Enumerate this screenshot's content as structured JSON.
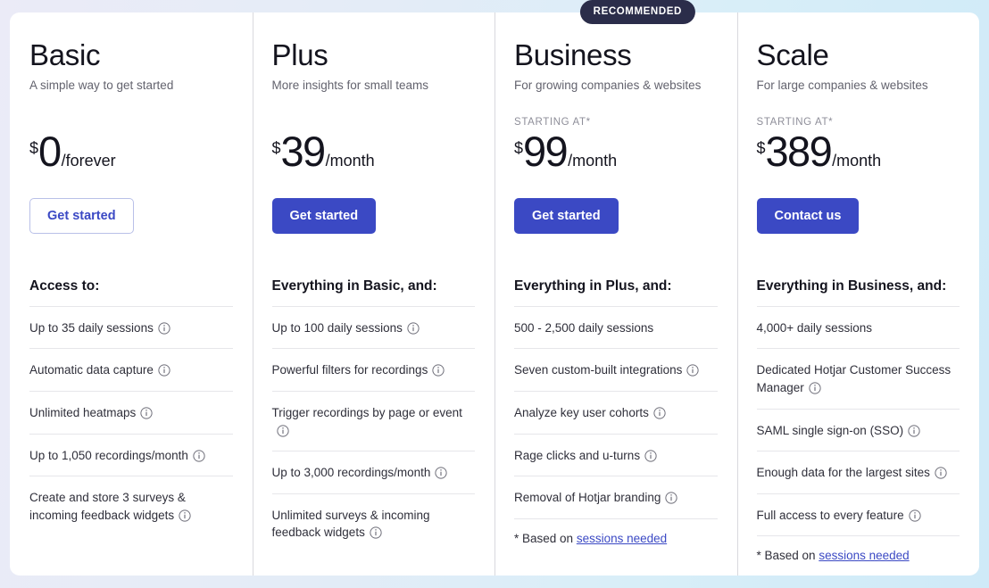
{
  "badge": {
    "recommended_label": "RECOMMENDED"
  },
  "icons": {
    "info": "info-icon"
  },
  "colors": {
    "accent": "#3b49c4",
    "badge_background": "#2b2d4a",
    "text_primary": "#14141e",
    "text_muted": "#63636e",
    "divider": "#e6e6ea"
  },
  "plans": [
    {
      "id": "basic",
      "name": "Basic",
      "tagline": "A simple way to get started",
      "starting_at": "",
      "currency": "$",
      "amount": "0",
      "period": "/forever",
      "cta_label": "Get started",
      "cta_style": "outline",
      "recommended": false,
      "features_heading": "Access to:",
      "features": [
        {
          "text": "Up to 35 daily sessions",
          "info": true
        },
        {
          "text": "Automatic data capture",
          "info": true
        },
        {
          "text": "Unlimited heatmaps",
          "info": true
        },
        {
          "text": "Up to 1,050 recordings/month",
          "info": true
        },
        {
          "text": "Create and store 3 surveys & incoming feedback widgets",
          "info": true
        }
      ],
      "footnote": null
    },
    {
      "id": "plus",
      "name": "Plus",
      "tagline": "More insights for small teams",
      "starting_at": "",
      "currency": "$",
      "amount": "39",
      "period": "/month",
      "cta_label": "Get started",
      "cta_style": "filled",
      "recommended": false,
      "features_heading": "Everything in Basic, and:",
      "features": [
        {
          "text": "Up to 100 daily sessions",
          "info": true
        },
        {
          "text": "Powerful filters for recordings",
          "info": true
        },
        {
          "text": "Trigger recordings by page or event",
          "info": true
        },
        {
          "text": "Up to 3,000 recordings/month",
          "info": true
        },
        {
          "text": "Unlimited surveys & incoming feedback widgets",
          "info": true
        }
      ],
      "footnote": null
    },
    {
      "id": "business",
      "name": "Business",
      "tagline": "For growing companies & websites",
      "starting_at": "STARTING AT*",
      "currency": "$",
      "amount": "99",
      "period": "/month",
      "cta_label": "Get started",
      "cta_style": "filled",
      "recommended": true,
      "features_heading": "Everything in Plus, and:",
      "features": [
        {
          "text": "500 - 2,500 daily sessions",
          "info": false
        },
        {
          "text": "Seven custom-built integrations",
          "info": true
        },
        {
          "text": "Analyze key user cohorts",
          "info": true
        },
        {
          "text": "Rage clicks and u-turns",
          "info": true
        },
        {
          "text": "Removal of Hotjar branding",
          "info": true
        }
      ],
      "footnote": {
        "prefix": "* Based on ",
        "link_text": "sessions needed"
      }
    },
    {
      "id": "scale",
      "name": "Scale",
      "tagline": "For large companies & websites",
      "starting_at": "STARTING AT*",
      "currency": "$",
      "amount": "389",
      "period": "/month",
      "cta_label": "Contact us",
      "cta_style": "filled",
      "recommended": false,
      "features_heading": "Everything in Business, and:",
      "features": [
        {
          "text": "4,000+ daily sessions",
          "info": false
        },
        {
          "text": "Dedicated Hotjar Customer Success Manager",
          "info": true
        },
        {
          "text": "SAML single sign-on (SSO)",
          "info": true
        },
        {
          "text": "Enough data for the largest sites",
          "info": true
        },
        {
          "text": "Full access to every feature",
          "info": true
        }
      ],
      "footnote": {
        "prefix": "* Based on ",
        "link_text": "sessions needed"
      }
    }
  ]
}
